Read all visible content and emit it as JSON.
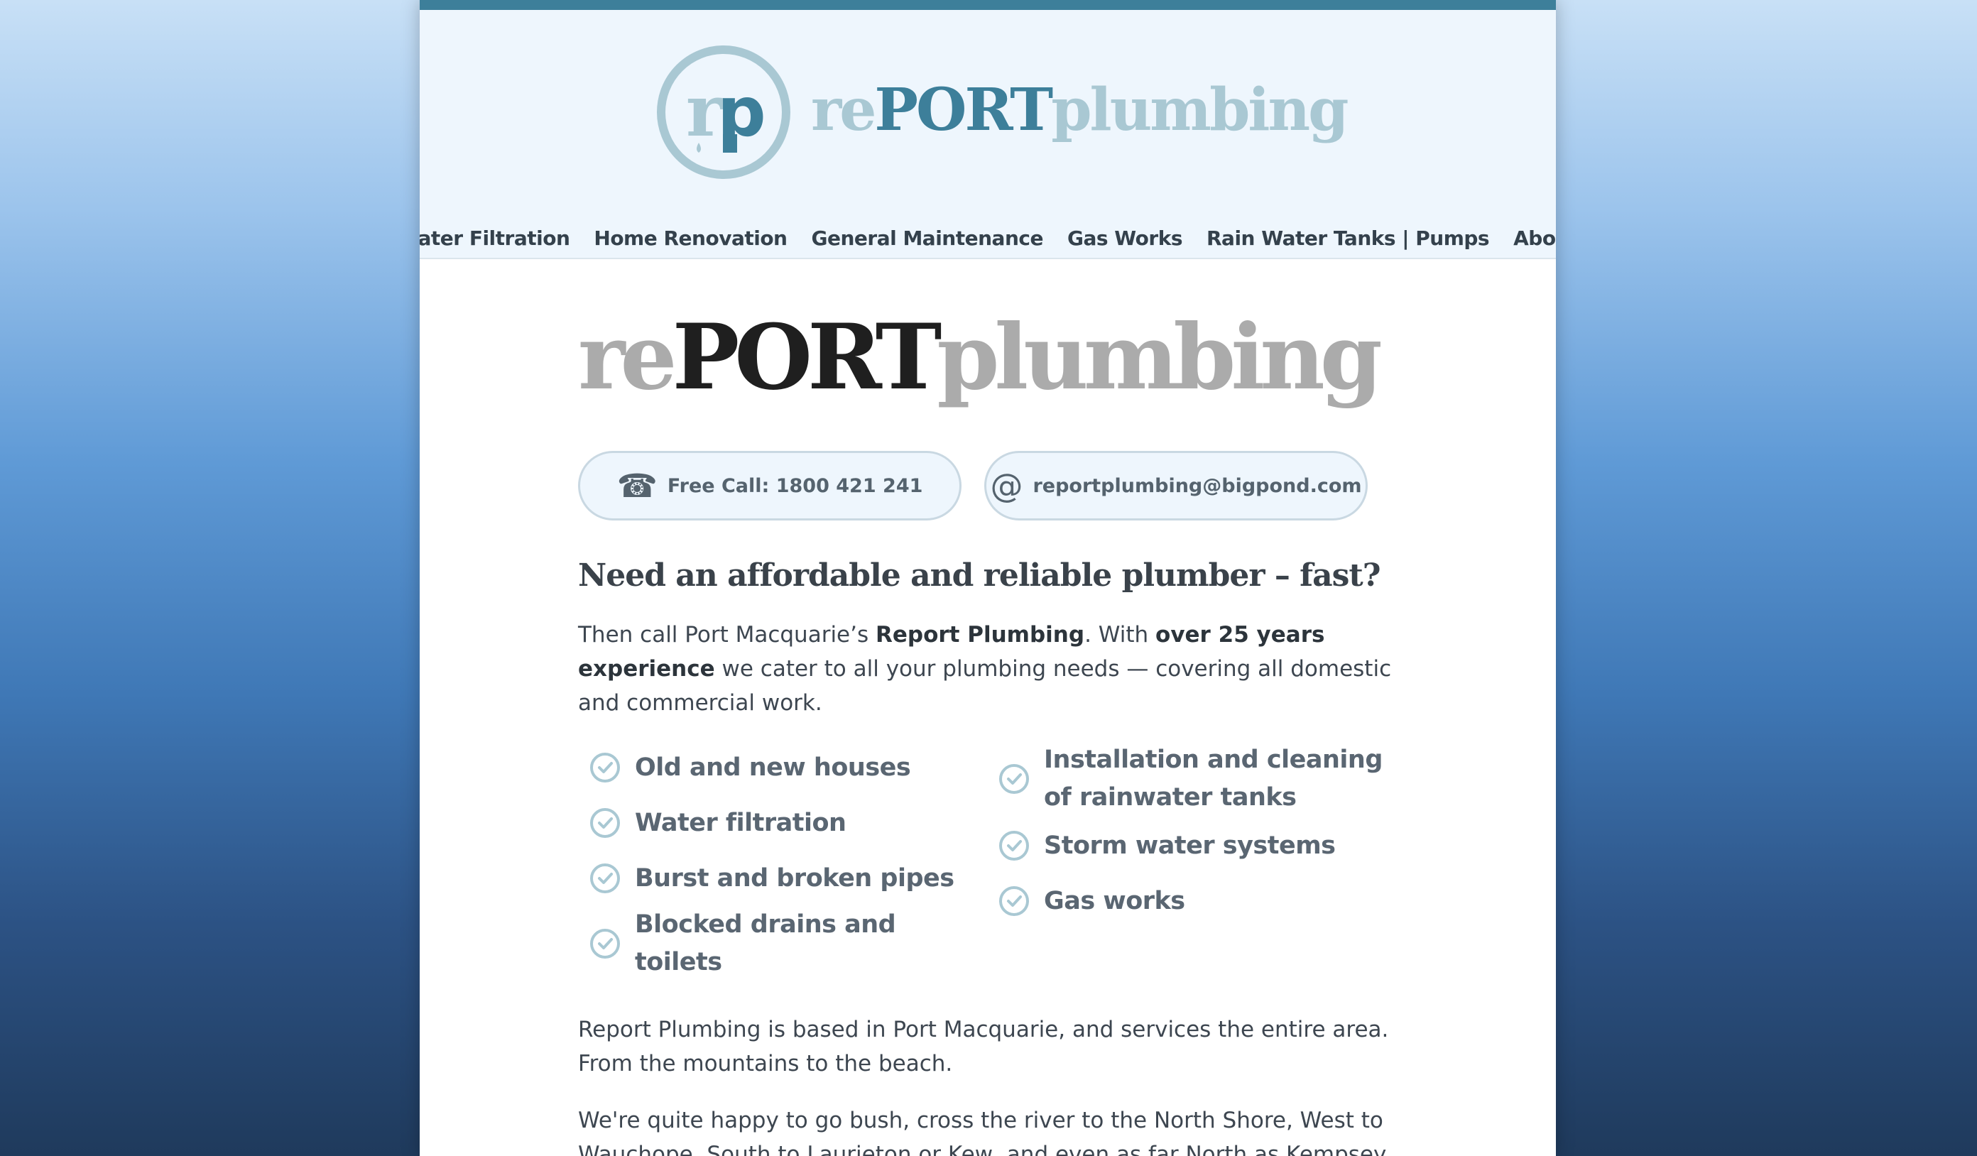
{
  "brand": {
    "mark_letters": "rp",
    "word_re": "re",
    "word_port": "PORT",
    "word_plumbing": "plumbing"
  },
  "nav": {
    "items": [
      {
        "label": "Water Filtration"
      },
      {
        "label": "Home Renovation"
      },
      {
        "label": "General Maintenance"
      },
      {
        "label": "Gas Works"
      },
      {
        "label": "Rain Water Tanks | Pumps"
      },
      {
        "label": "About"
      }
    ]
  },
  "hero": {
    "title_re": "re",
    "title_port": "PORT",
    "title_plumbing": "plumbing"
  },
  "contacts": {
    "phone_icon": "phone-icon",
    "phone_label": "Free Call: 1800 421 241",
    "email_icon": "at-icon",
    "email_label": "reportplumbing@bigpond.com"
  },
  "main": {
    "headline": "Need an affordable and reliable plumber – fast?",
    "intro_1": "Then call Port Macquarie’s ",
    "intro_bold_1": "Report Plumbing",
    "intro_2": ". With ",
    "intro_bold_2": "over 25 years experience",
    "intro_3": " we cater to all your plumbing needs — covering all domestic and commercial work.",
    "services_left": [
      "Old and new houses",
      "Water filtration",
      "Burst and broken pipes",
      "Blocked drains and toilets"
    ],
    "services_right": [
      "Installation and cleaning of rainwater tanks",
      "Storm water systems",
      "Gas works"
    ],
    "para_2": "Report Plumbing is based in Port Macquarie, and services the entire area. From the mountains to the beach.",
    "para_3": "We're quite happy to go bush, cross the river to the North Shore, West to Wauchope, South to Laurieton or Kew, and even as far North as Kempsey."
  },
  "colors": {
    "accent": "#3d7f9a",
    "accent_light": "#a9c8d3",
    "header_bg": "#eef6fd"
  }
}
